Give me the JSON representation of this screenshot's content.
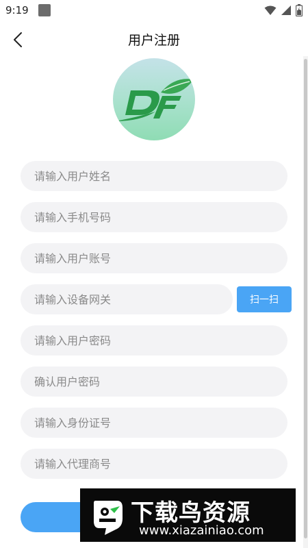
{
  "status_bar": {
    "time": "9:19",
    "icons": [
      "app-notification-icon",
      "wifi-icon",
      "cell-signal-icon",
      "battery-icon"
    ]
  },
  "header": {
    "title": "用户注册",
    "back_icon": "chevron-left-icon"
  },
  "logo": {
    "text": "DF",
    "colors": {
      "text": "#2a9a4a",
      "leaf": "#3aa855"
    }
  },
  "form": {
    "fields": [
      {
        "name": "user-name-input",
        "placeholder": "请输入用户姓名",
        "value": ""
      },
      {
        "name": "phone-input",
        "placeholder": "请输入手机号码",
        "value": ""
      },
      {
        "name": "account-input",
        "placeholder": "请输入用户账号",
        "value": ""
      },
      {
        "name": "gateway-input",
        "placeholder": "请输入设备网关",
        "value": ""
      },
      {
        "name": "password-input",
        "placeholder": "请输入用户密码",
        "value": ""
      },
      {
        "name": "confirm-password-input",
        "placeholder": "确认用户密码",
        "value": ""
      },
      {
        "name": "id-card-input",
        "placeholder": "请输入身份证号",
        "value": ""
      },
      {
        "name": "agent-number-input",
        "placeholder": "请输入代理商号",
        "value": ""
      }
    ],
    "scan_label": "扫一扫"
  },
  "watermark": {
    "main": "下载鸟资源",
    "url": "www.xiazainiao.com"
  },
  "colors": {
    "accent": "#4aa5f5",
    "field_bg": "#f3f3f5",
    "placeholder": "#8a8a8a"
  }
}
